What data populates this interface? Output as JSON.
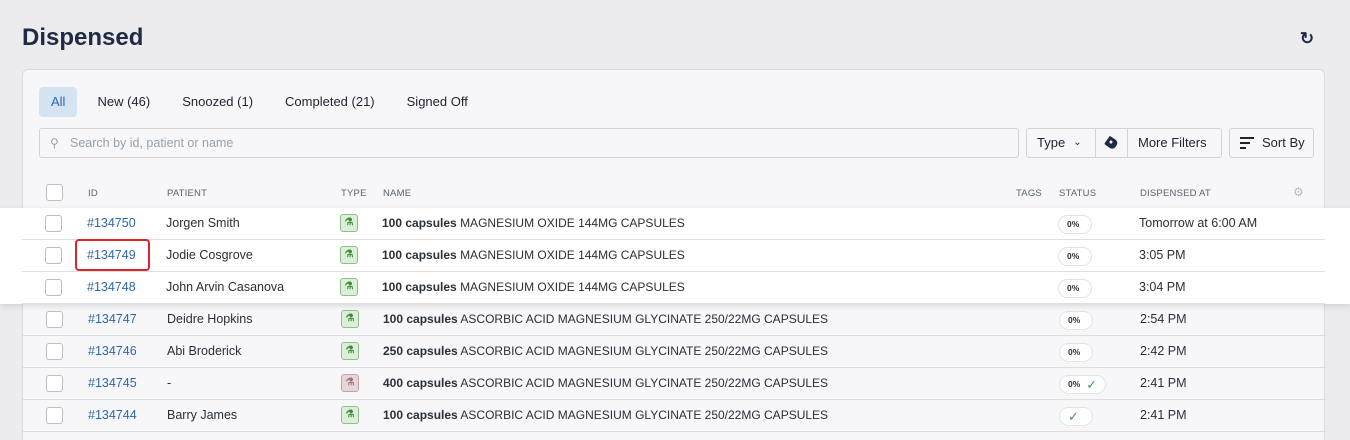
{
  "page": {
    "title": "Dispensed"
  },
  "tabs": [
    {
      "label": "All",
      "active": true
    },
    {
      "label": "New (46)",
      "active": false
    },
    {
      "label": "Snoozed (1)",
      "active": false
    },
    {
      "label": "Completed (21)",
      "active": false
    },
    {
      "label": "Signed Off",
      "active": false
    }
  ],
  "search": {
    "placeholder": "Search by id, patient or name",
    "value": ""
  },
  "filters": {
    "type_label": "Type",
    "more_label": "More Filters",
    "sort_label": "Sort By"
  },
  "table": {
    "headers": {
      "id": "ID",
      "patient": "PATIENT",
      "type": "TYPE",
      "name": "NAME",
      "tags": "TAGS",
      "status": "STATUS",
      "dispensed_at": "DISPENSED AT"
    },
    "rows": [
      {
        "id": "#134750",
        "patient": "Jorgen Smith",
        "type": "green",
        "qty": "100 capsules",
        "product": "MAGNESIUM OXIDE 144MG CAPSULES",
        "status": "0%",
        "done": false,
        "dispensed_at": "Tomorrow at 6:00 AM"
      },
      {
        "id": "#134749",
        "patient": "Jodie Cosgrove",
        "type": "green",
        "qty": "100 capsules",
        "product": "MAGNESIUM OXIDE 144MG CAPSULES",
        "status": "0%",
        "done": false,
        "dispensed_at": "3:05 PM"
      },
      {
        "id": "#134748",
        "patient": "John Arvin Casanova",
        "type": "green",
        "qty": "100 capsules",
        "product": "MAGNESIUM OXIDE 144MG CAPSULES",
        "status": "0%",
        "done": false,
        "dispensed_at": "3:04 PM"
      },
      {
        "id": "#134747",
        "patient": "Deidre Hopkins",
        "type": "green",
        "qty": "100 capsules",
        "product": "ASCORBIC ACID MAGNESIUM GLYCINATE 250/22MG CAPSULES",
        "status": "0%",
        "done": false,
        "dispensed_at": "2:54 PM"
      },
      {
        "id": "#134746",
        "patient": "Abi Broderick",
        "type": "green",
        "qty": "250 capsules",
        "product": "ASCORBIC ACID MAGNESIUM GLYCINATE 250/22MG CAPSULES",
        "status": "0%",
        "done": false,
        "dispensed_at": "2:42 PM"
      },
      {
        "id": "#134745",
        "patient": "-",
        "type": "red",
        "qty": "400 capsules",
        "product": "ASCORBIC ACID MAGNESIUM GLYCINATE 250/22MG CAPSULES",
        "status": "0%",
        "done": true,
        "dispensed_at": "2:41 PM"
      },
      {
        "id": "#134744",
        "patient": "Barry James",
        "type": "green",
        "qty": "100 capsules",
        "product": "ASCORBIC ACID MAGNESIUM GLYCINATE 250/22MG CAPSULES",
        "status": "",
        "done": true,
        "dispensed_at": "2:41 PM"
      }
    ]
  }
}
